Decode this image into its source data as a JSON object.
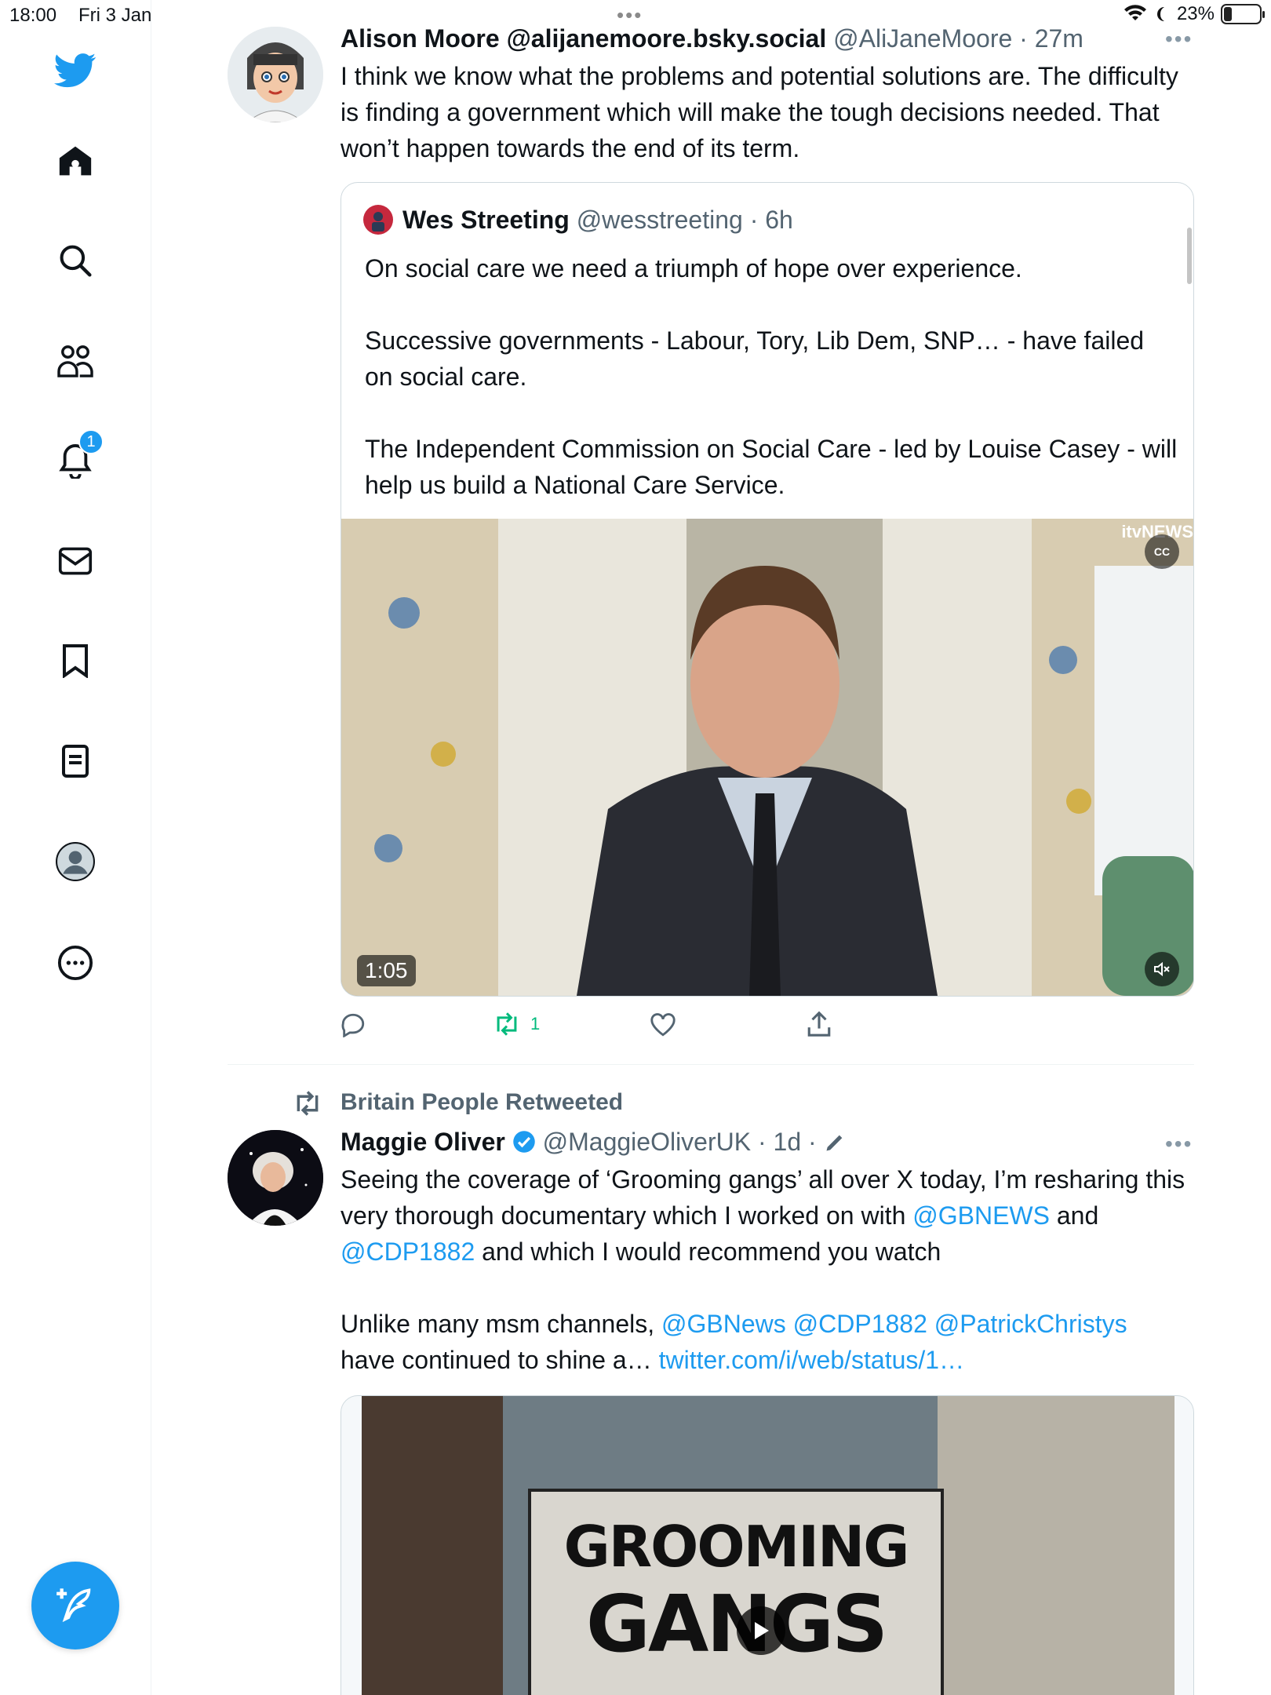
{
  "status_bar": {
    "time": "18:00",
    "date": "Fri 3 Jan",
    "battery": "23%",
    "battery_level": 0.23
  },
  "sidebar": {
    "items": [
      {
        "name": "logo",
        "icon": "bird-icon"
      },
      {
        "name": "home",
        "icon": "home-icon"
      },
      {
        "name": "explore",
        "icon": "search-icon"
      },
      {
        "name": "communities",
        "icon": "people-icon"
      },
      {
        "name": "notifications",
        "icon": "bell-icon",
        "badge": "1"
      },
      {
        "name": "messages",
        "icon": "mail-icon"
      },
      {
        "name": "bookmarks",
        "icon": "bookmark-icon"
      },
      {
        "name": "lists",
        "icon": "list-icon"
      },
      {
        "name": "profile",
        "icon": "avatar-icon"
      },
      {
        "name": "more",
        "icon": "more-circle-icon"
      }
    ],
    "compose_icon": "compose-icon"
  },
  "tweet1": {
    "display_name": "Alison Moore @alijanemoore.bsky.social",
    "handle_time": "@AliJaneMoore · 27m",
    "text": "I think we know what the problems and potential solutions are. The difficulty is finding a government which will make the tough decisions needed. That won’t happen towards the end of its term.",
    "quote": {
      "display_name": "Wes Streeting",
      "handle_time": "@wesstreeting · 6h",
      "line1": "On social care we need a triumph of hope over experience.",
      "line2": "Successive governments - Labour, Tory, Lib Dem, SNP… - have failed on social care.",
      "line3": "The Independent Commission on Social Care - led by Louise Casey - will help us build a National Care Service.",
      "video_duration": "1:05",
      "video_watermark": "itvNEWS",
      "cc_label": "CC"
    },
    "actions": {
      "reply": "",
      "retweet": "1",
      "like": "",
      "share": ""
    }
  },
  "tweet2": {
    "retweeted_by": "Britain People Retweeted",
    "display_name": "Maggie Oliver",
    "handle_time": "@MaggieOliverUK · 1d ·",
    "text_a": "Seeing the coverage of ‘Grooming gangs’ all over X today, I’m resharing this very thorough documentary which I worked on with ",
    "mention_gbnews": "@GBNEWS",
    "text_and": " and ",
    "mention_cdp": "@CDP1882",
    "text_b": " and which I would recommend you watch",
    "text_c": "Unlike many msm channels, ",
    "mentions_row": "@GBNews @CDP1882 @PatrickChristys",
    "text_d": "have continued to shine a… ",
    "link": "twitter.com/i/web/status/1…",
    "card_title_1": "GROOMING",
    "card_title_2": "GANGS"
  }
}
